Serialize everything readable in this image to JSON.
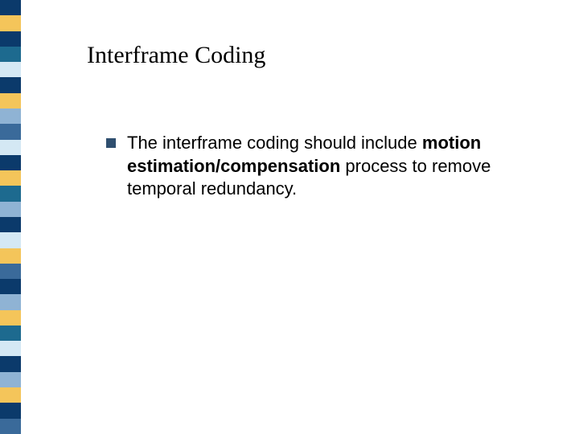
{
  "sidebar_colors": [
    "#0b3a6b",
    "#f4c55a",
    "#0b3a6b",
    "#1d6a8f",
    "#d4e8f4",
    "#0b3a6b",
    "#f4c55a",
    "#8fb3d4",
    "#3a6a9a",
    "#d4e8f4",
    "#0b3a6b",
    "#f4c55a",
    "#1d6a8f",
    "#8fb3d4",
    "#0b3a6b",
    "#d4e8f4",
    "#f4c55a",
    "#3a6a9a",
    "#0b3a6b",
    "#8fb3d4",
    "#f4c55a",
    "#1d6a8f",
    "#d4e8f4",
    "#0b3a6b",
    "#8fb3d4",
    "#f4c55a",
    "#0b3a6b",
    "#3a6a9a"
  ],
  "title": "Interframe Coding",
  "bullet": {
    "pre": "The interframe coding should include ",
    "bold": "motion estimation/compensation",
    "post": " process to remove temporal redundancy."
  }
}
